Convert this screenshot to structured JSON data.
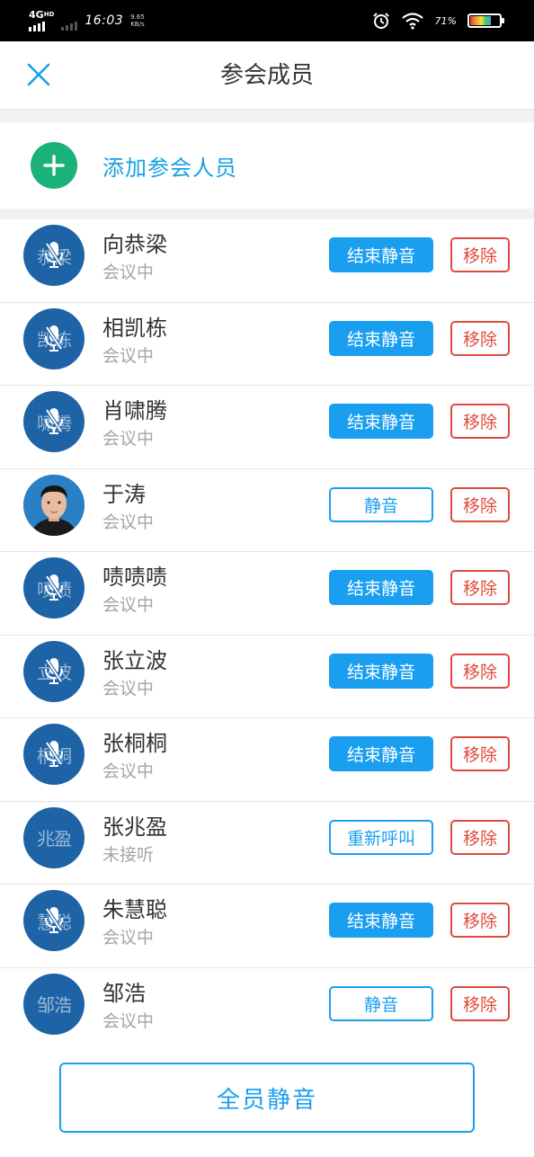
{
  "status_bar": {
    "network": "4G",
    "network_sup": "HD",
    "time": "16:03",
    "speed_value": "9.65",
    "speed_unit": "KB/s",
    "battery_pct": "71%",
    "battery_level": 0.71,
    "icons": [
      "signal-icon",
      "alarm-icon",
      "wifi-icon",
      "battery-icon"
    ]
  },
  "header": {
    "title": "参会成员",
    "close_icon": "close-icon",
    "accent": "#1aa0e0"
  },
  "add_member": {
    "label": "添加参会人员",
    "icon": "plus-circle-icon",
    "icon_color": "#1ab27a"
  },
  "members": [
    {
      "name": "向恭梁",
      "avatar_text": "恭梁",
      "status": "会议中",
      "mic_off": true,
      "photo": false,
      "action": "结束静音",
      "action_style": "filled",
      "remove": "移除"
    },
    {
      "name": "相凯栋",
      "avatar_text": "凯栋",
      "status": "会议中",
      "mic_off": true,
      "photo": false,
      "action": "结束静音",
      "action_style": "filled",
      "remove": "移除"
    },
    {
      "name": "肖啸腾",
      "avatar_text": "啸腾",
      "status": "会议中",
      "mic_off": true,
      "photo": false,
      "action": "结束静音",
      "action_style": "filled",
      "remove": "移除"
    },
    {
      "name": "于涛",
      "avatar_text": "",
      "status": "会议中",
      "mic_off": false,
      "photo": true,
      "action": "静音",
      "action_style": "outline",
      "remove": "移除"
    },
    {
      "name": "啧啧啧",
      "avatar_text": "啧啧",
      "status": "会议中",
      "mic_off": true,
      "photo": false,
      "action": "结束静音",
      "action_style": "filled",
      "remove": "移除"
    },
    {
      "name": "张立波",
      "avatar_text": "立波",
      "status": "会议中",
      "mic_off": true,
      "photo": false,
      "action": "结束静音",
      "action_style": "filled",
      "remove": "移除"
    },
    {
      "name": "张桐桐",
      "avatar_text": "桐桐",
      "status": "会议中",
      "mic_off": true,
      "photo": false,
      "action": "结束静音",
      "action_style": "filled",
      "remove": "移除"
    },
    {
      "name": "张兆盈",
      "avatar_text": "兆盈",
      "status": "未接听",
      "mic_off": false,
      "photo": false,
      "action": "重新呼叫",
      "action_style": "outline",
      "remove": "移除"
    },
    {
      "name": "朱慧聪",
      "avatar_text": "慧聪",
      "status": "会议中",
      "mic_off": true,
      "photo": false,
      "action": "结束静音",
      "action_style": "filled",
      "remove": "移除"
    },
    {
      "name": "邹浩",
      "avatar_text": "邹浩",
      "status": "会议中",
      "mic_off": false,
      "photo": false,
      "action": "静音",
      "action_style": "outline",
      "remove": "移除"
    }
  ],
  "footer": {
    "mute_all_label": "全员静音"
  },
  "colors": {
    "primary": "#1a9ff0",
    "danger": "#e04a3c",
    "avatar_bg": "#1d63a6",
    "muted_text": "#a5a5a5"
  }
}
